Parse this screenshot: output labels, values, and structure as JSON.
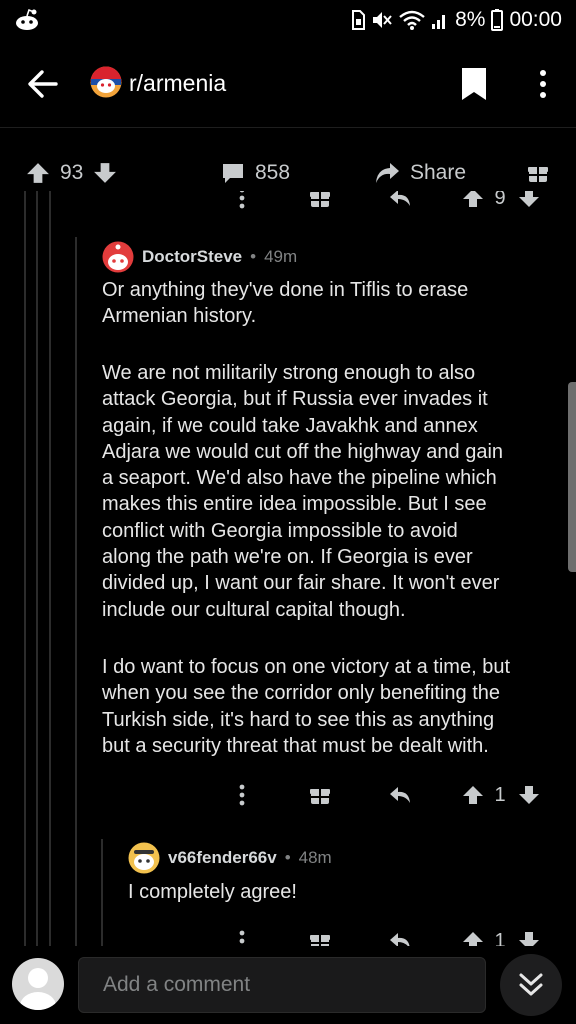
{
  "status": {
    "battery": "8%",
    "time": "00:00"
  },
  "header": {
    "subreddit": "r/armenia"
  },
  "post_actions": {
    "score": "93",
    "comments": "858",
    "share_label": "Share"
  },
  "peek_row": {
    "score": "9"
  },
  "comments": [
    {
      "user": "DoctorSteve",
      "age": "49m",
      "paragraphs": [
        [
          "Or anything they've done in Tiflis to erase",
          "Armenian history."
        ],
        [
          "We are not militarily strong enough to also",
          "attack Georgia, but if Russia ever invades it",
          "again, if we could take Javakhk and annex",
          "Adjara we would cut off the highway and gain",
          "a seaport. We'd also have the pipeline which",
          "makes this entire idea impossible. But I see",
          "conflict with Georgia impossible to avoid",
          "along the path we're on. If Georgia is ever",
          "divided up, I want our fair share. It won't ever",
          "include our cultural capital though."
        ],
        [
          "I do want to focus on one victory at a time, but",
          "when you see the corridor only benefiting the",
          "Turkish side, it's hard to see this as anything",
          "but a security threat that must be dealt with."
        ]
      ],
      "score": "1"
    },
    {
      "user": "v66fender66v",
      "age": "48m",
      "paragraphs": [
        [
          "I completely agree!"
        ]
      ],
      "score": "1"
    }
  ],
  "composer": {
    "placeholder": "Add a comment"
  },
  "colors": {
    "background": "#000000",
    "text": "#d7dadc",
    "muted": "#818384",
    "thread_line": "#2c2c2c"
  }
}
